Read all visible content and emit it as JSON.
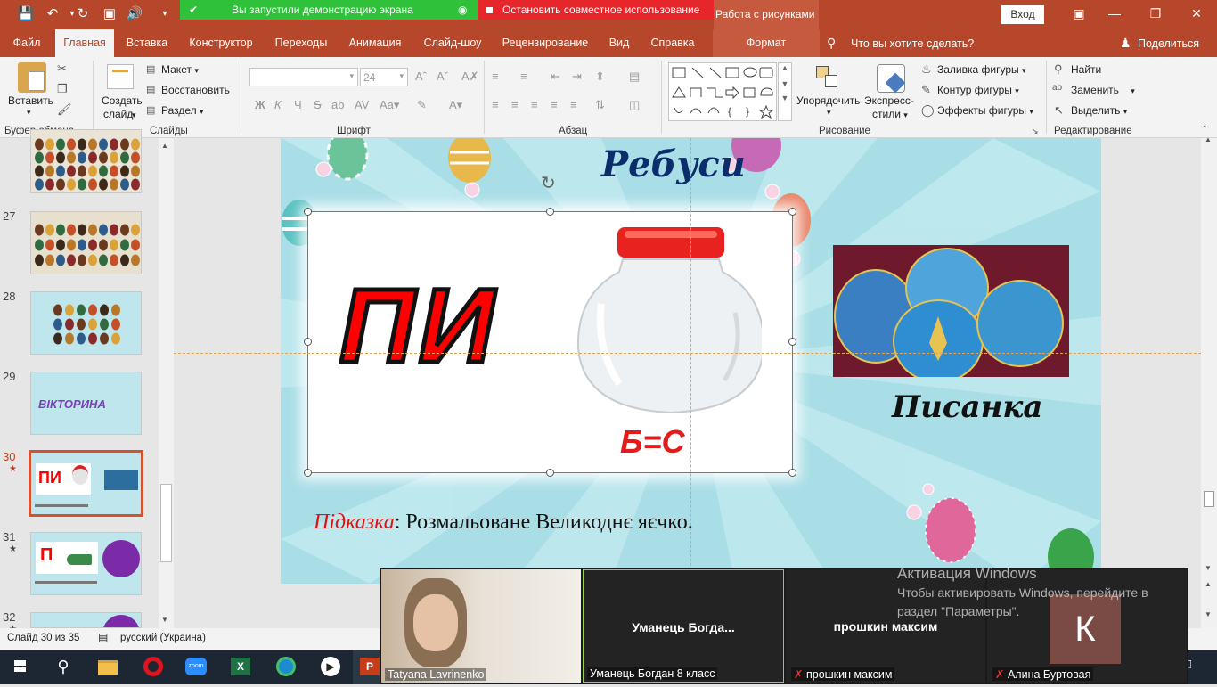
{
  "share_bar": {
    "status": "Вы запустили демонстрацию экрана",
    "stop": "Остановить совместное использование"
  },
  "title": {
    "context_group": "Работа с рисунками",
    "login": "Вход"
  },
  "tabs": [
    {
      "label": "Файл"
    },
    {
      "label": "Главная"
    },
    {
      "label": "Вставка"
    },
    {
      "label": "Конструктор"
    },
    {
      "label": "Переходы"
    },
    {
      "label": "Анимация"
    },
    {
      "label": "Слайд-шоу"
    },
    {
      "label": "Рецензирование"
    },
    {
      "label": "Вид"
    },
    {
      "label": "Справка"
    },
    {
      "label": "Формат"
    }
  ],
  "tell_me": "Что вы хотите сделать?",
  "share_label": "Поделиться",
  "ribbon": {
    "paste": "Вставить",
    "clipboard": "Буфер обмена",
    "new_slide_line1": "Создать",
    "new_slide_line2": "слайд",
    "layout": "Макет",
    "reset": "Восстановить",
    "section": "Раздел",
    "slides": "Слайды",
    "font_size": "24",
    "font": "Шрифт",
    "paragraph": "Абзац",
    "arrange": "Упорядочить",
    "quick_styles_line1": "Экспресс-",
    "quick_styles_line2": "стили",
    "shape_fill": "Заливка фигуры",
    "shape_outline": "Контур фигуры",
    "shape_effects": "Эффекты фигуры",
    "drawing": "Рисование",
    "find": "Найти",
    "replace": "Заменить",
    "select": "Выделить",
    "editing": "Редактирование",
    "bold": "Ж",
    "italic": "К",
    "underline": "Ч",
    "strike": "S"
  },
  "thumbnails": [
    {
      "num": "27"
    },
    {
      "num": "28"
    },
    {
      "num": "29",
      "text": "ВІКТОРИНА"
    },
    {
      "num": "30",
      "star": "★",
      "text": "ПИ"
    },
    {
      "num": "31",
      "star": "★",
      "text": "П"
    },
    {
      "num": "32",
      "star": "★"
    }
  ],
  "slide": {
    "title": "Ребуси",
    "rebus_text": "ПИ",
    "equation": "Б=С",
    "answer": "Писанка",
    "hint_label": "Підказка",
    "hint_text": ": Розмальоване Великоднє яєчко."
  },
  "activation": {
    "title": "Активация Windows",
    "line1": "Чтобы активировать Windows, перейдите в",
    "line2": "раздел \"Параметры\"."
  },
  "status": {
    "slide": "Слайд 30 из 35",
    "language": "русский (Украина)"
  },
  "zoom": {
    "tiles": [
      {
        "name": "Tatyana Lavrinenko"
      },
      {
        "center": "Уманець  Богда...",
        "name": "Уманець Богдан 8 класс"
      },
      {
        "center": "прошкин максим",
        "name": "прошкин максим"
      },
      {
        "initial": "К",
        "name": "Алина Буртовая"
      }
    ]
  },
  "colors": {
    "accent": "#b7472a",
    "slide_bg": "#a9dee6",
    "title_blue": "#0c2d6b",
    "rebus_red": "#ff0000",
    "hint_red": "#e01010"
  }
}
